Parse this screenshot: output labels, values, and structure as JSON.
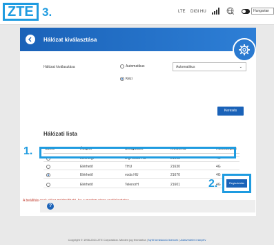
{
  "header": {
    "logo": "ZTE",
    "step_label": "3.",
    "network_type": "LTE",
    "carrier": "DIGI HU",
    "language": "Hungarian"
  },
  "page": {
    "title": "Hálózat kiválasztása"
  },
  "selection": {
    "label": "Hálózat kiválasztása",
    "option_auto": "Automatikus",
    "option_manual": "Kézi",
    "selected_mode": "manual",
    "auto_dropdown_value": "Automatikus",
    "search_button": "Keresés"
  },
  "list": {
    "title": "Hálózati lista",
    "headers": {
      "option": "Opció",
      "status": "Állapot",
      "provider": "Szolgáltató",
      "mccmnc": "MCCMNC",
      "type": "Hálózattípus"
    },
    "rows": [
      {
        "status": "Jelenlegi",
        "provider": "Digi Mobil HU",
        "mccmnc": "21603",
        "type": "4G",
        "selected": false
      },
      {
        "status": "Elérhető",
        "provider": "THU",
        "mccmnc": "21630",
        "type": "4G",
        "selected": false
      },
      {
        "status": "Elérhető",
        "provider": "voda HU",
        "mccmnc": "21670",
        "type": "4G",
        "selected": true
      },
      {
        "status": "Elérhető",
        "provider": "TelenorH",
        "mccmnc": "21601",
        "type": "4G",
        "selected": false
      }
    ]
  },
  "annotations": {
    "step1": "1.",
    "step2": "2."
  },
  "register_button": "Regisztrálás",
  "warning": "A beállítás csak akkor módosítható, ha a modem nincs csatlakoztatva.",
  "help_icon_label": "?",
  "footer": {
    "copyright": "Copyright © 1998-2021 ZTE Corporation. Minden jog fenntartva",
    "sep": "|",
    "link1": "Nyílt forráskódú licencek",
    "link2": "Adatvédelmi irányelv"
  },
  "colors": {
    "accent": "#1a62b8",
    "annotation": "#1e9be0",
    "warning": "#c0392b"
  }
}
